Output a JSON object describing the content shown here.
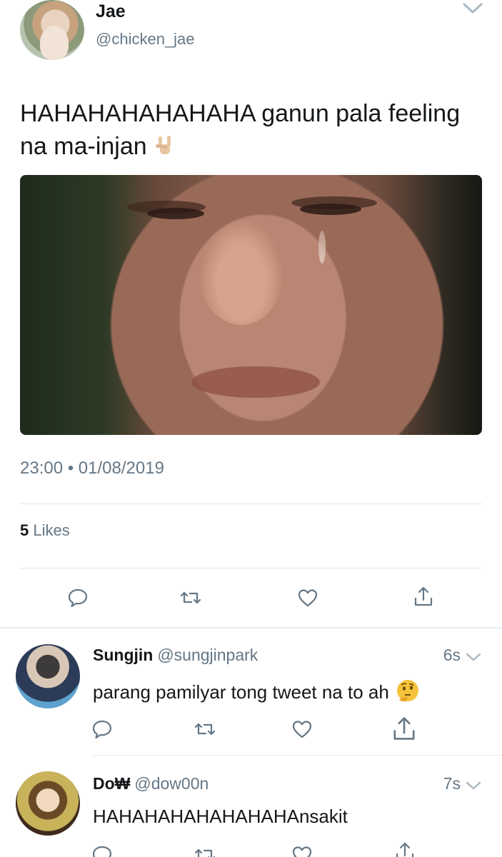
{
  "main_tweet": {
    "author_name": "Jae",
    "author_handle": "@chicken_jae",
    "text": "HAHAHAHAHAHAHA ganun pala feeling na ma-injan",
    "emoji": "sign-of-horns-emoji",
    "timestamp": "23:00 • 01/08/2019",
    "likes_count": "5",
    "likes_label": "Likes",
    "actions": [
      "reply-icon",
      "retweet-icon",
      "like-icon",
      "share-icon"
    ]
  },
  "replies": [
    {
      "author_name": "Sungjin",
      "author_handle": "@sungjinpark",
      "time": "6s",
      "text": "parang pamilyar tong tweet na to ah",
      "emoji": "thinking-face-emoji"
    },
    {
      "author_name": "Do₩",
      "author_handle": "@dow00n",
      "time": "7s",
      "text": "HAHAHAHAHAHAHAHAnsakit",
      "emoji": ""
    }
  ],
  "colors": {
    "text_primary": "#14171a",
    "text_secondary": "#657786",
    "divider": "#e1e8ed",
    "icon": "#657786"
  }
}
